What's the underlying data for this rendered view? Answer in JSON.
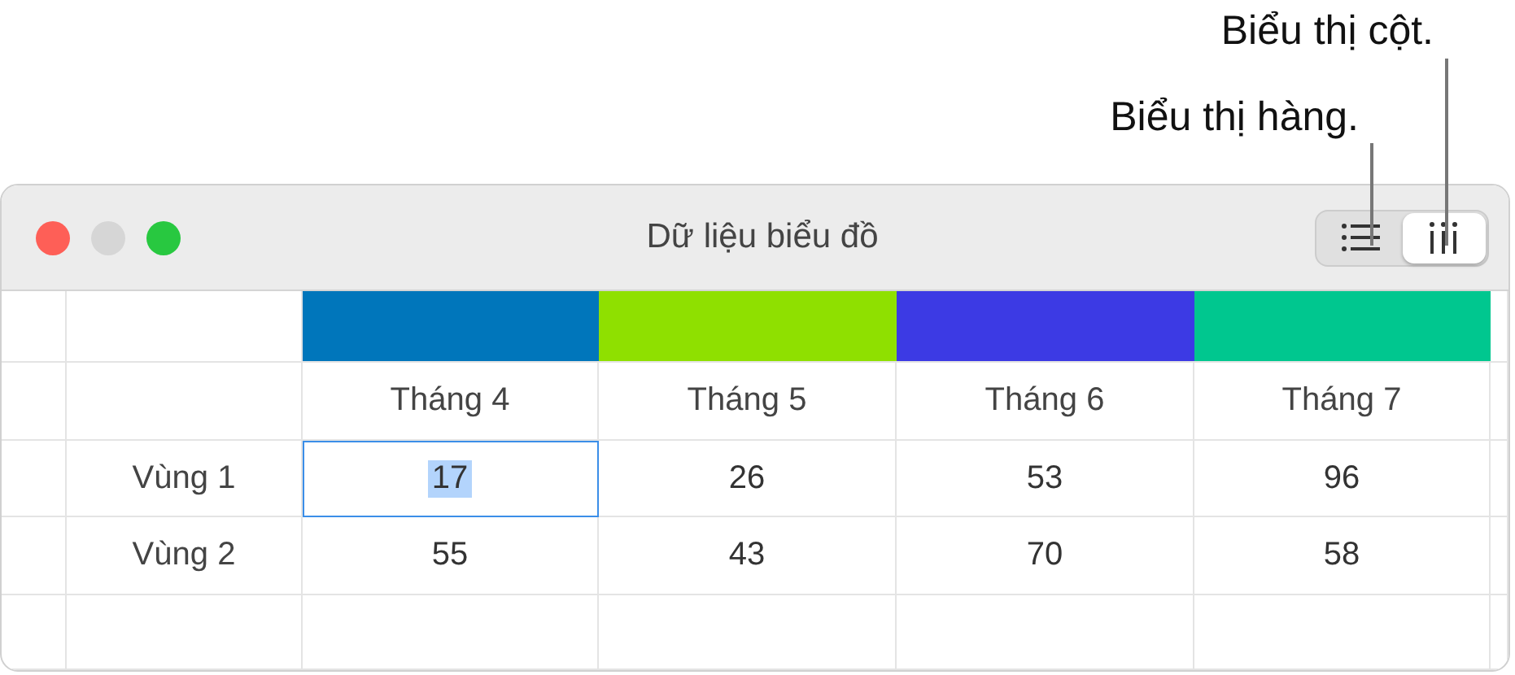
{
  "callouts": [
    {
      "text": "Biểu thị cột."
    },
    {
      "text": "Biểu thị hàng."
    }
  ],
  "window": {
    "title": "Dữ liệu biểu đồ"
  },
  "view_toggle": [
    {
      "kind": "rows",
      "selected": false
    },
    {
      "kind": "columns",
      "selected": true
    }
  ],
  "table": {
    "columns": [
      {
        "label": "Tháng 4",
        "color": "#0076bb"
      },
      {
        "label": "Tháng 5",
        "color": "#8fe000"
      },
      {
        "label": "Tháng 6",
        "color": "#3c3ae4"
      },
      {
        "label": "Tháng 7",
        "color": "#00c78f"
      }
    ],
    "rows": [
      {
        "label": "Vùng 1",
        "cells": [
          {
            "value": "17",
            "selected": true
          },
          {
            "value": "26",
            "selected": false
          },
          {
            "value": "53",
            "selected": false
          },
          {
            "value": "96",
            "selected": false
          }
        ]
      },
      {
        "label": "Vùng 2",
        "cells": [
          {
            "value": "55",
            "selected": false
          },
          {
            "value": "43",
            "selected": false
          },
          {
            "value": "70",
            "selected": false
          },
          {
            "value": "58",
            "selected": false
          }
        ]
      }
    ]
  }
}
